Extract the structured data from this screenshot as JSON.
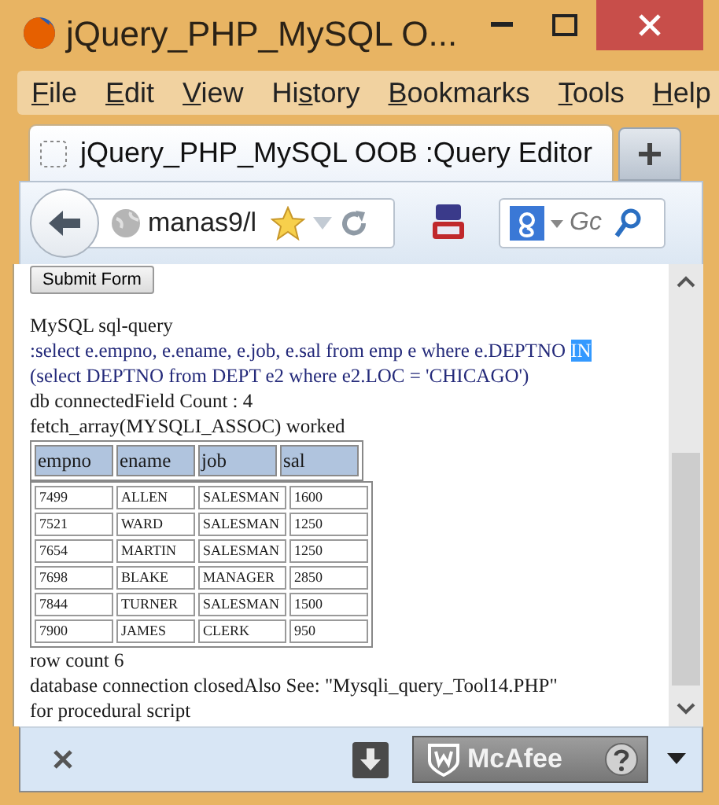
{
  "window": {
    "title": "jQuery_PHP_MySQL O..."
  },
  "menu": [
    {
      "key": "F",
      "after": "ile"
    },
    {
      "key": "E",
      "after": "dit"
    },
    {
      "key": "V",
      "after": "iew"
    },
    {
      "before": "Hi",
      "key": "s",
      "after": "tory"
    },
    {
      "key": "B",
      "after": "ookmarks"
    },
    {
      "key": "T",
      "after": "ools"
    },
    {
      "key": "H",
      "after": "elp"
    }
  ],
  "tabs": [
    {
      "label": "jQuery_PHP_MySQL OOB :Query Editor",
      "selected": true
    }
  ],
  "address_bar": {
    "value": "manas9/l"
  },
  "search": {
    "placeholder": "Gc"
  },
  "page": {
    "submit_button": "Submit Form",
    "heading": "MySQL sql-query",
    "query_lines": [
      [
        {
          "text": ":select e.empno, e.ename, e.job, e.sal from emp e where e.DEPTNO ",
          "selected": false
        },
        {
          "text": "IN",
          "selected": true
        }
      ],
      [
        {
          "text": "(select DEPTNO from DEPT e2 where e2.LOC = 'CHICAGO')",
          "selected": false
        }
      ]
    ],
    "status_lines": [
      "db connectedField Count : 4",
      "fetch_array(MYSQLI_ASSOC) worked"
    ],
    "table": {
      "columns": [
        "empno",
        "ename",
        "job",
        "sal"
      ],
      "rows": [
        [
          "7499",
          "ALLEN",
          "SALESMAN",
          "1600"
        ],
        [
          "7521",
          "WARD",
          "SALESMAN",
          "1250"
        ],
        [
          "7654",
          "MARTIN",
          "SALESMAN",
          "1250"
        ],
        [
          "7698",
          "BLAKE",
          "MANAGER",
          "2850"
        ],
        [
          "7844",
          "TURNER",
          "SALESMAN",
          "1500"
        ],
        [
          "7900",
          "JAMES",
          "CLERK",
          "950"
        ]
      ]
    },
    "footer_lines": [
      "row count 6",
      "database connection closedAlso See: \"Mysqli_query_Tool14.PHP\"",
      "for procedural script"
    ]
  },
  "addon_bar": {
    "mcafee": "McAfee"
  }
}
